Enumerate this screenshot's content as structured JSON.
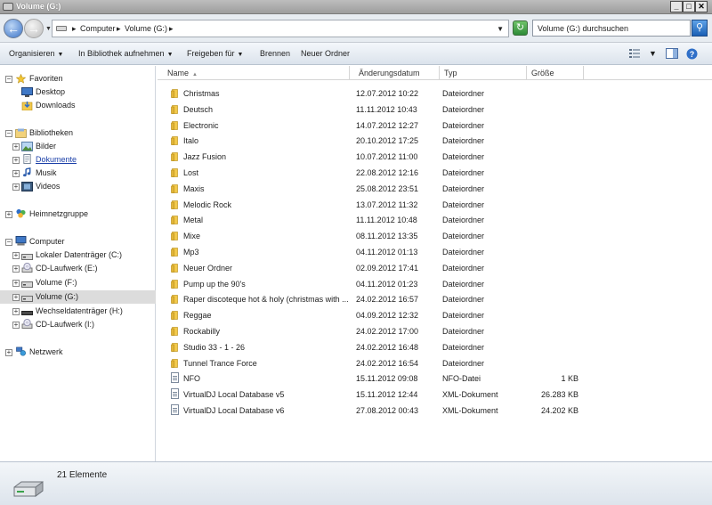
{
  "window": {
    "title": "Volume (G:)"
  },
  "address": {
    "crumbs": [
      "Computer",
      "Volume (G:)"
    ],
    "search_placeholder": "Volume (G:) durchsuchen"
  },
  "toolbar": {
    "organize": "Organisieren",
    "include_library": "In Bibliothek aufnehmen",
    "share": "Freigeben für",
    "burn": "Brennen",
    "new_folder": "Neuer Ordner"
  },
  "nav": {
    "favorites": {
      "label": "Favoriten",
      "items": [
        "Desktop",
        "Downloads"
      ]
    },
    "libraries": {
      "label": "Bibliotheken",
      "items": [
        "Bilder",
        "Dokumente",
        "Musik",
        "Videos"
      ]
    },
    "homegroup": "Heimnetzgruppe",
    "computer": {
      "label": "Computer",
      "items": [
        "Lokaler Datenträger (C:)",
        "CD-Laufwerk (E:)",
        "Volume (F:)",
        "Volume (G:)",
        "Wechseldatenträger (H:)",
        "CD-Laufwerk (I:)"
      ]
    },
    "network": "Netzwerk"
  },
  "columns": {
    "name": "Name",
    "modified": "Änderungsdatum",
    "type": "Typ",
    "size": "Größe"
  },
  "files": [
    {
      "name": "Christmas",
      "modified": "12.07.2012 10:22",
      "type": "Dateiordner",
      "size": "",
      "kind": "folder"
    },
    {
      "name": "Deutsch",
      "modified": "11.11.2012 10:43",
      "type": "Dateiordner",
      "size": "",
      "kind": "folder"
    },
    {
      "name": "Electronic",
      "modified": "14.07.2012 12:27",
      "type": "Dateiordner",
      "size": "",
      "kind": "folder"
    },
    {
      "name": "Italo",
      "modified": "20.10.2012 17:25",
      "type": "Dateiordner",
      "size": "",
      "kind": "folder"
    },
    {
      "name": "Jazz Fusion",
      "modified": "10.07.2012 11:00",
      "type": "Dateiordner",
      "size": "",
      "kind": "folder"
    },
    {
      "name": "Lost",
      "modified": "22.08.2012 12:16",
      "type": "Dateiordner",
      "size": "",
      "kind": "folder"
    },
    {
      "name": "Maxis",
      "modified": "25.08.2012 23:51",
      "type": "Dateiordner",
      "size": "",
      "kind": "folder"
    },
    {
      "name": "Melodic Rock",
      "modified": "13.07.2012 11:32",
      "type": "Dateiordner",
      "size": "",
      "kind": "folder"
    },
    {
      "name": "Metal",
      "modified": "11.11.2012 10:48",
      "type": "Dateiordner",
      "size": "",
      "kind": "folder"
    },
    {
      "name": "Mixe",
      "modified": "08.11.2012 13:35",
      "type": "Dateiordner",
      "size": "",
      "kind": "folder"
    },
    {
      "name": "Mp3",
      "modified": "04.11.2012 01:13",
      "type": "Dateiordner",
      "size": "",
      "kind": "folder"
    },
    {
      "name": "Neuer Ordner",
      "modified": "02.09.2012 17:41",
      "type": "Dateiordner",
      "size": "",
      "kind": "folder"
    },
    {
      "name": "Pump up the 90's",
      "modified": "04.11.2012 01:23",
      "type": "Dateiordner",
      "size": "",
      "kind": "folder"
    },
    {
      "name": "Raper discoteque hot & holy (christmas with ...",
      "modified": "24.02.2012 16:57",
      "type": "Dateiordner",
      "size": "",
      "kind": "folder"
    },
    {
      "name": "Reggae",
      "modified": "04.09.2012 12:32",
      "type": "Dateiordner",
      "size": "",
      "kind": "folder"
    },
    {
      "name": "Rockabilly",
      "modified": "24.02.2012 17:00",
      "type": "Dateiordner",
      "size": "",
      "kind": "folder"
    },
    {
      "name": "Studio 33 - 1 - 26",
      "modified": "24.02.2012 16:48",
      "type": "Dateiordner",
      "size": "",
      "kind": "folder"
    },
    {
      "name": "Tunnel Trance Force",
      "modified": "24.02.2012 16:54",
      "type": "Dateiordner",
      "size": "",
      "kind": "folder"
    },
    {
      "name": "NFO",
      "modified": "15.11.2012 09:08",
      "type": "NFO-Datei",
      "size": "1 KB",
      "kind": "file"
    },
    {
      "name": "VirtualDJ Local Database v5",
      "modified": "15.11.2012 12:44",
      "type": "XML-Dokument",
      "size": "26.283 KB",
      "kind": "file"
    },
    {
      "name": "VirtualDJ Local Database v6",
      "modified": "27.08.2012 00:43",
      "type": "XML-Dokument",
      "size": "24.202 KB",
      "kind": "file"
    }
  ],
  "status": {
    "count": "21 Elemente"
  },
  "colors": {
    "folder": "#f2c94c",
    "accent": "#3c74c8",
    "selected": "#dcdcdc",
    "link": "#1a3fa8"
  }
}
